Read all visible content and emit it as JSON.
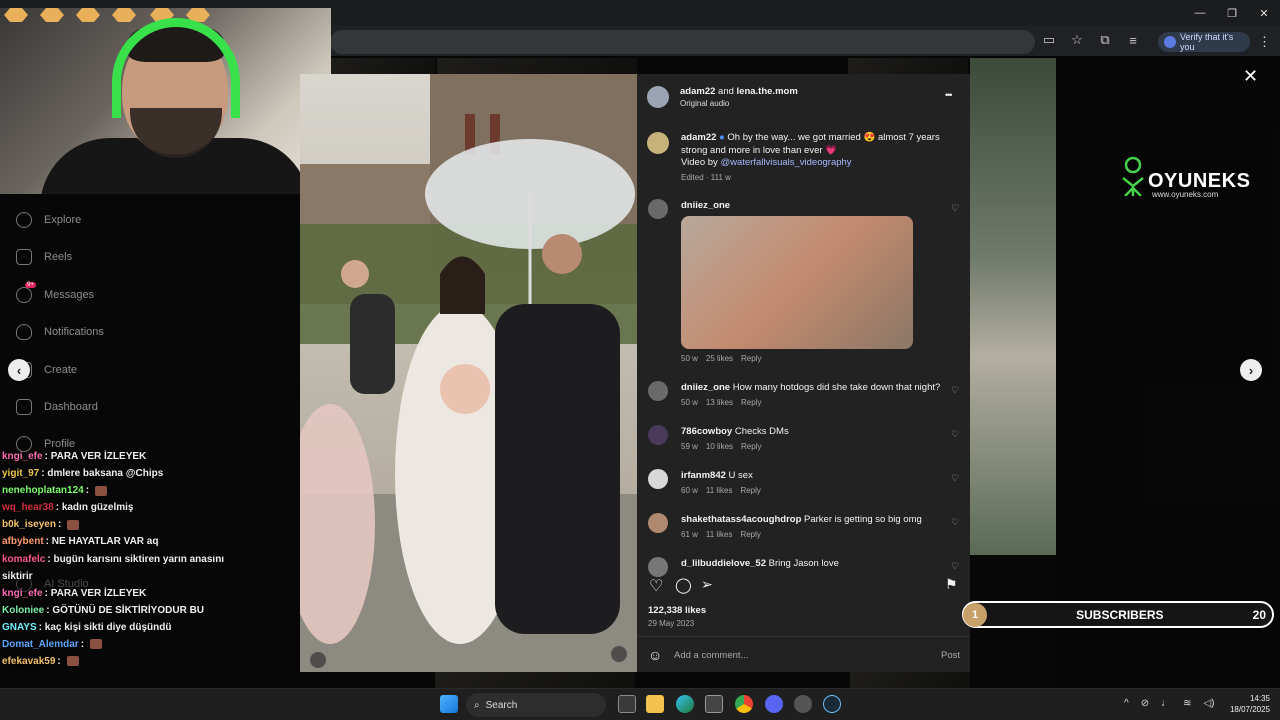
{
  "browser": {
    "verify_label": "Verify that it's you",
    "window_controls": {
      "minimize": "—",
      "restore": "❐",
      "close": "✕"
    }
  },
  "sidebar": {
    "items": [
      {
        "label": "Explore",
        "icon": "compass-icon"
      },
      {
        "label": "Reels",
        "icon": "reels-icon"
      },
      {
        "label": "Messages",
        "icon": "messages-icon",
        "badge": "9+"
      },
      {
        "label": "Notifications",
        "icon": "heart-icon"
      },
      {
        "label": "Create",
        "icon": "plus-icon"
      },
      {
        "label": "Dashboard",
        "icon": "dashboard-icon"
      },
      {
        "label": "Profile",
        "icon": "profile-icon"
      }
    ],
    "ai_studio": "AI Studio"
  },
  "chat": {
    "lines": [
      {
        "user": "kngi_efe",
        "msg": "PARA VER İZLEYEK",
        "color": "#ff6fb5"
      },
      {
        "user": "yigit_97",
        "msg": "dmlere baksana @Chips",
        "color": "#f0c64a"
      },
      {
        "user": "nenehoplatan124",
        "msg": "",
        "color": "#7dfc6e"
      },
      {
        "user": "wq_hear38",
        "msg": "kadın güzelmiş",
        "color": "#d4303f"
      },
      {
        "user": "b0k_iseyen",
        "msg": "",
        "color": "#f5c16c"
      },
      {
        "user": "afbybent",
        "msg": "NE HAYATLAR VAR aq",
        "color": "#ff9a6a"
      },
      {
        "user": "komafelc",
        "msg": "bugün karısını siktiren yarın anasını",
        "color": "#ff5a8a"
      },
      {
        "user": "",
        "msg": "siktirir",
        "color": "#ffffff"
      },
      {
        "user": "kngi_efe",
        "msg": "PARA VER İZLEYEK",
        "color": "#ff6fb5"
      },
      {
        "user": "Koloniee",
        "msg": "GÖTÜNÜ DE SİKTİRİYODUR BU",
        "color": "#7ef0a8"
      },
      {
        "user": "GNAYS",
        "msg": "kaç kişi sikti diye düşündü",
        "color": "#6ff0ff"
      },
      {
        "user": "Domat_Alemdar",
        "msg": "",
        "color": "#5aa8ff"
      },
      {
        "user": "efekavak59",
        "msg": "",
        "color": "#f5c16c"
      }
    ]
  },
  "post": {
    "header_user1": "adam22",
    "header_and": "and",
    "header_user2": "lena.the.mom",
    "audio": "Original audio",
    "more_icon": "•••",
    "caption_user": "adam22",
    "caption_text": "Oh by the way... we got married 😍 almost 7 years strong and more in love than ever 💗",
    "caption_video_prefix": "Video by",
    "caption_video_link": "@waterfallvisuals_videography",
    "caption_meta": "Edited · 111 w",
    "comments": [
      {
        "user": "dniiez_one",
        "text": "",
        "time": "50 w",
        "likes": "25 likes",
        "reply": "Reply",
        "has_image": true
      },
      {
        "user": "dniiez_one",
        "text": "How many hotdogs did she take down that night?",
        "time": "50 w",
        "likes": "13 likes",
        "reply": "Reply"
      },
      {
        "user": "786cowboy",
        "text": "Checks DMs",
        "time": "59 w",
        "likes": "10 likes",
        "reply": "Reply"
      },
      {
        "user": "irfanm842",
        "text": "U sex",
        "time": "60 w",
        "likes": "11 likes",
        "reply": "Reply"
      },
      {
        "user": "shakethatass4acoughdrop",
        "text": "Parker is getting so big omg",
        "time": "61 w",
        "likes": "11 likes",
        "reply": "Reply"
      },
      {
        "user": "d_lilbuddielove_52",
        "text": "Bring Jason love",
        "time": "",
        "likes": "",
        "reply": ""
      }
    ],
    "likes": "122,338 likes",
    "date": "29 May 2023",
    "comment_placeholder": "Add a comment...",
    "post_button": "Post"
  },
  "overlay": {
    "logo_text": "OYUNEKS",
    "logo_url": "www.oyuneks.com",
    "subs_rank": "1",
    "subs_label": "SUBSCRIBERS",
    "subs_count": "20"
  },
  "taskbar": {
    "search": "Search",
    "time": "14:35",
    "date": "18/07/2025"
  }
}
